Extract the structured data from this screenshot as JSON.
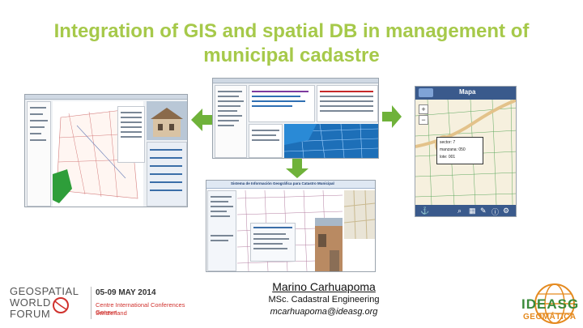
{
  "slide": {
    "title": "Integration of GIS and spatial DB in management of municipal cadastre",
    "author_name": "Marino Carhuapoma",
    "author_role": "MSc. Cadastral Engineering",
    "author_email": "mcarhuapoma@ideasg.org"
  },
  "screens": {
    "web_portal_title": "Sistema de Información Geográfica para Catastro Municipal",
    "mobile_title": "Mapa",
    "mobile_popup": [
      "sector: 7",
      "manzana: 050",
      "lote: 001"
    ]
  },
  "event_logo": {
    "line1": "GEOSPATIAL",
    "line2": "WORLD",
    "line3": "FORUM",
    "date": "05-09 MAY 2014",
    "venue_line1": "Centre International Conferences Geneve",
    "venue_line2": "Switzerland"
  },
  "org_logo": {
    "word": "IDEASG",
    "sub": "GEOMÁTICA"
  },
  "colors": {
    "title": "#a6c94a",
    "arrow": "#6fb23a",
    "gwf_red": "#d0312d",
    "ideasg_green": "#3a8a3a",
    "ideasg_orange": "#e58a1f"
  }
}
